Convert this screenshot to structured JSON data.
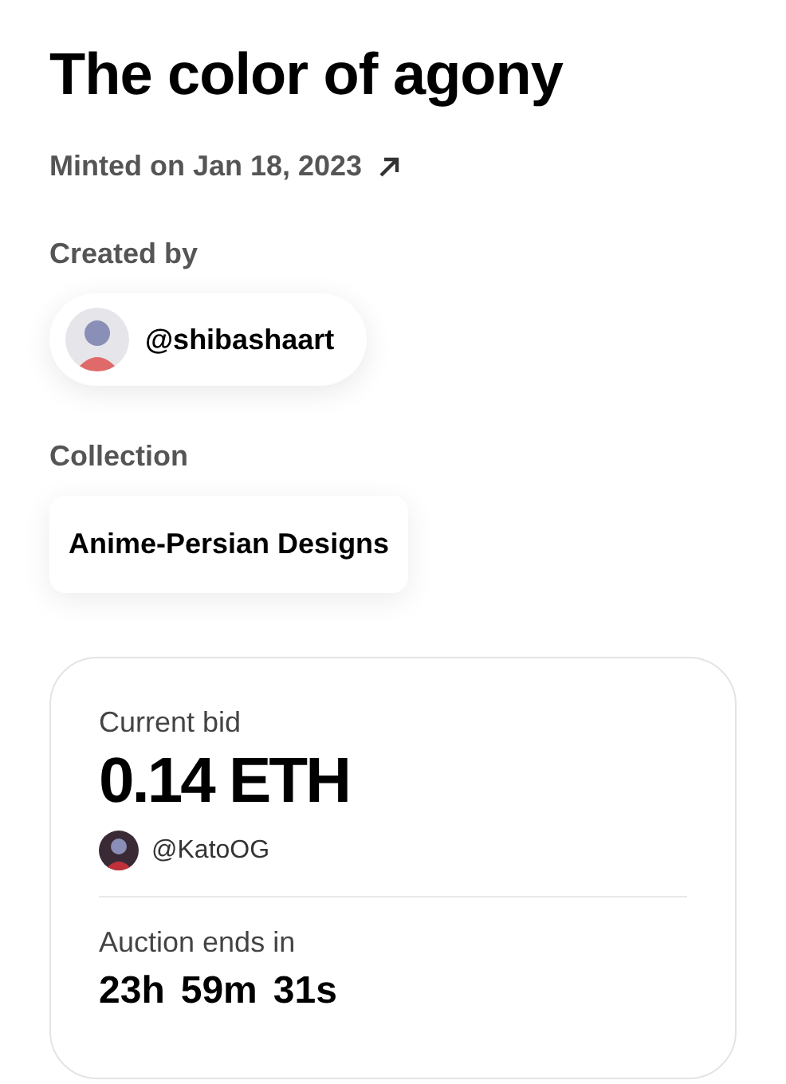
{
  "title": "The color of agony",
  "minted": {
    "text": "Minted on Jan 18, 2023"
  },
  "creator": {
    "label": "Created by",
    "handle": "@shibashaart"
  },
  "collection": {
    "label": "Collection",
    "name": "Anime-Persian Designs"
  },
  "auction": {
    "bid_label": "Current bid",
    "bid": "0.14 ETH",
    "bidder": "@KatoOG",
    "ends_label": "Auction ends in",
    "countdown": [
      "23h",
      "59m",
      "31s"
    ]
  }
}
